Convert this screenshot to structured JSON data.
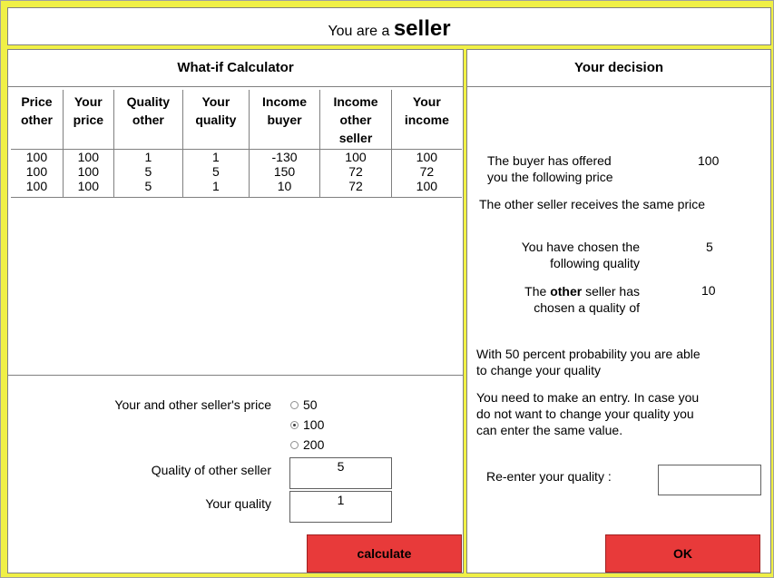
{
  "header": {
    "prefix": "You are a",
    "role": "seller"
  },
  "calculator": {
    "title": "What-if Calculator",
    "columns": [
      [
        "Price",
        "other"
      ],
      [
        "Your",
        "price"
      ],
      [
        "Quality",
        "other"
      ],
      [
        "Your",
        "quality"
      ],
      [
        "Income",
        "buyer"
      ],
      [
        "Income",
        "other",
        "seller"
      ],
      [
        "Your",
        "income"
      ]
    ],
    "rows": [
      [
        "100",
        "100",
        "1",
        "1",
        "-130",
        "100",
        "100"
      ],
      [
        "100",
        "100",
        "5",
        "5",
        "150",
        "72",
        "72"
      ],
      [
        "100",
        "100",
        "5",
        "1",
        "10",
        "72",
        "100"
      ]
    ],
    "price_label": "Your and other seller's price",
    "price_options": [
      "50",
      "100",
      "200"
    ],
    "price_selected": "100",
    "other_quality_label": "Quality of other seller",
    "other_quality_value": "5",
    "your_quality_label": "Your quality",
    "your_quality_value": "1",
    "calculate_label": "calculate"
  },
  "decision": {
    "title": "Your decision",
    "offer_text_1": "The buyer has offered",
    "offer_text_2": "you the following price",
    "offer_value": "100",
    "same_price_text": "The other seller receives the same price",
    "chosen_1": "You have chosen the",
    "chosen_2": "following quality",
    "chosen_value": "5",
    "other_1a": "The ",
    "other_1b": "other",
    "other_1c": " seller has",
    "other_2": "chosen a quality of",
    "other_value": "10",
    "prob_1": "With 50 percent probability you are able",
    "prob_2": "to change your quality",
    "entry_1": "You need to make an entry. In case you",
    "entry_2": "do not want to change your quality you",
    "entry_3": "can enter the same value.",
    "reenter_label": "Re-enter your quality :",
    "reenter_value": "",
    "ok_label": "OK"
  },
  "colors": {
    "background": "#f0f046",
    "button": "#e83a3a"
  }
}
